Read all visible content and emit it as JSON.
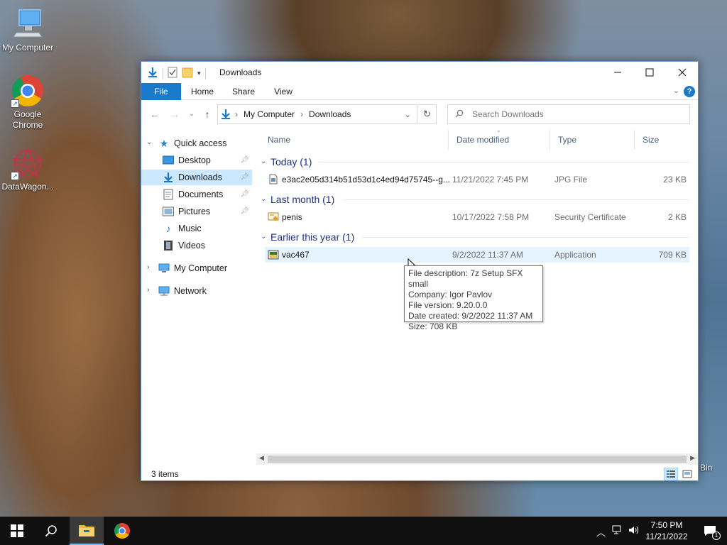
{
  "desktop": {
    "icons": [
      {
        "label": "My Computer"
      },
      {
        "label": "Google Chrome"
      },
      {
        "label": "DataWagon..."
      }
    ],
    "recycle_bin_label": "Bin"
  },
  "window": {
    "title": "Downloads",
    "ribbon_tabs": [
      "File",
      "Home",
      "Share",
      "View"
    ],
    "address": {
      "segments": [
        "My Computer",
        "Downloads"
      ]
    },
    "search": {
      "placeholder": "Search Downloads"
    }
  },
  "navpane": {
    "quick_access": "Quick access",
    "items": [
      {
        "label": "Desktop",
        "pinned": true
      },
      {
        "label": "Downloads",
        "pinned": true,
        "selected": true
      },
      {
        "label": "Documents",
        "pinned": true
      },
      {
        "label": "Pictures",
        "pinned": true
      },
      {
        "label": "Music"
      },
      {
        "label": "Videos"
      }
    ],
    "my_computer": "My Computer",
    "network": "Network"
  },
  "columns": [
    "Name",
    "Date modified",
    "Type",
    "Size"
  ],
  "groups": [
    {
      "title": "Today (1)",
      "files": [
        {
          "name": "e3ac2e05d314b51d53d1c4ed94d75745--g...",
          "date": "11/21/2022 7:45 PM",
          "type": "JPG File",
          "size": "23 KB"
        }
      ]
    },
    {
      "title": "Last month (1)",
      "files": [
        {
          "name": "penis",
          "date": "10/17/2022 7:58 PM",
          "type": "Security Certificate",
          "size": "2 KB"
        }
      ]
    },
    {
      "title": "Earlier this year (1)",
      "files": [
        {
          "name": "vac467",
          "date": "9/2/2022 11:37 AM",
          "type": "Application",
          "size": "709 KB"
        }
      ]
    }
  ],
  "tooltip": {
    "lines": [
      "File description: 7z Setup SFX small",
      "Company: Igor Pavlov",
      "File version: 9.20.0.0",
      "Date created: 9/2/2022 11:37 AM",
      "Size: 708 KB"
    ]
  },
  "status": {
    "item_count": "3 items"
  },
  "taskbar": {
    "time": "7:50 PM",
    "date": "11/21/2022",
    "notification_count": "1"
  },
  "colors": {
    "accent": "#1979ca",
    "selection": "#cce8ff",
    "group_title": "#1e3287"
  }
}
